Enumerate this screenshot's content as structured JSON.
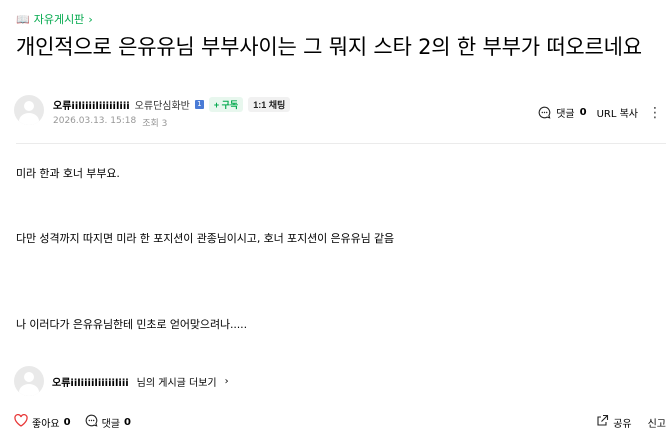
{
  "board": {
    "icon": "book-icon",
    "name": "자유게시판",
    "chevron": "›"
  },
  "post": {
    "title": "개인적으로 은유유님 부부사이는 그 뭐지 스타 2의 한 부부가 떠오르네요",
    "author": {
      "nickname": "오류iiliiiiliiiiiliii",
      "level": "오류단심화반",
      "level_badge": "1",
      "subscribe_label": "+ 구독",
      "chat_label": "1:1 채팅"
    },
    "date": "2026.03.13. 15:18",
    "views": "조회 3",
    "body": [
      "미라 한과 호너 부부요.",
      "다만 성격까지 따지면 미라 한 포지션이 관종님이시고, 호너 포지션이 은유유님 같음",
      "나 이러다가 은유유님한테 민초로 얻어맞으려나....."
    ]
  },
  "toolbar": {
    "comment_label": "댓글",
    "comment_count": "0",
    "url_copy_label": "URL 복사",
    "more_icon": "more-vertical-icon"
  },
  "author_footer": {
    "nickname": "오류iiliiiiliiiiiliii",
    "suffix": "님의 게시글 더보기",
    "chevron": "›"
  },
  "bottom_bar": {
    "like_label": "좋아요",
    "like_count": "0",
    "comment_label": "댓글",
    "comment_count": "0",
    "share_label": "공유",
    "report_label": "신고"
  },
  "colors": {
    "accent_green": "#03a94d",
    "like_red": "#e83a3a"
  }
}
